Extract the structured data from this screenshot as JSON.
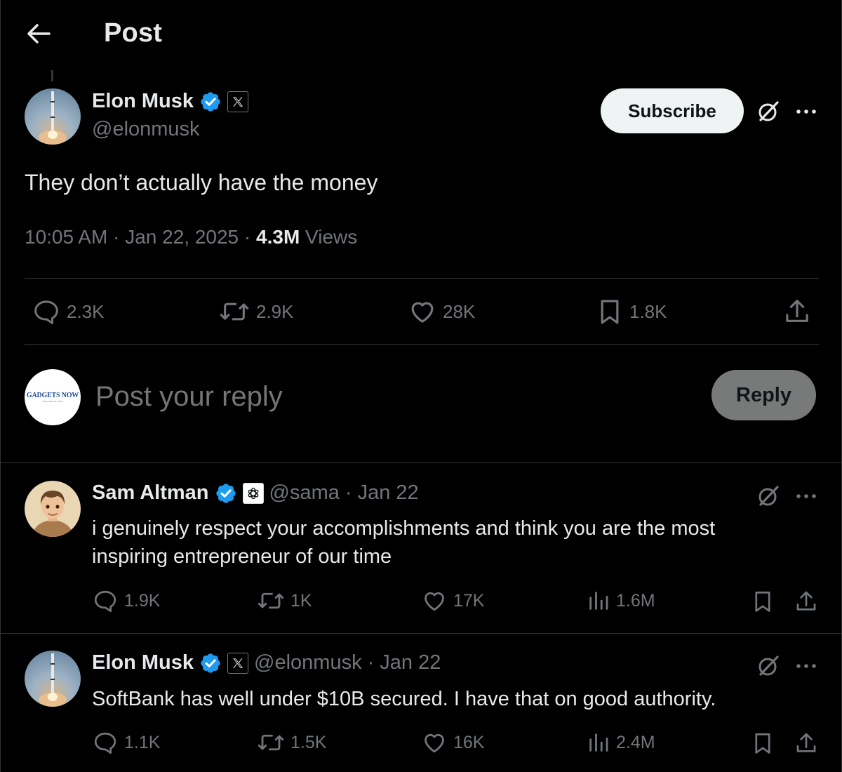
{
  "header": {
    "title": "Post"
  },
  "main_post": {
    "author": "Elon Musk",
    "handle": "@elonmusk",
    "subscribe_label": "Subscribe",
    "text": "They don’t actually have the money",
    "time": "10:05 AM",
    "date": "Jan 22, 2025",
    "views_count": "4.3M",
    "views_label": "Views",
    "stats": {
      "replies": "2.3K",
      "reposts": "2.9K",
      "likes": "28K",
      "bookmarks": "1.8K"
    }
  },
  "composer": {
    "placeholder": "Post your reply",
    "reply_label": "Reply",
    "avatar_logo": "GADGETS NOW",
    "avatar_sub": "THE TIMES OF INDIA"
  },
  "replies": [
    {
      "author": "Sam Altman",
      "handle": "@sama",
      "date": "Jan 22",
      "text": "i genuinely respect your accomplishments and think you are the most inspiring entrepreneur of our time",
      "stats": {
        "replies": "1.9K",
        "reposts": "1K",
        "likes": "17K",
        "views": "1.6M"
      }
    },
    {
      "author": "Elon Musk",
      "handle": "@elonmusk",
      "date": "Jan 22",
      "text": "SoftBank has well under $10B secured. I have that on good authority.",
      "stats": {
        "replies": "1.1K",
        "reposts": "1.5K",
        "likes": "16K",
        "views": "2.4M"
      }
    }
  ],
  "colors": {
    "background": "#000000",
    "text_primary": "#e7e9ea",
    "text_secondary": "#71767b",
    "verified_blue": "#1d9bf0",
    "divider": "#2f3336"
  }
}
